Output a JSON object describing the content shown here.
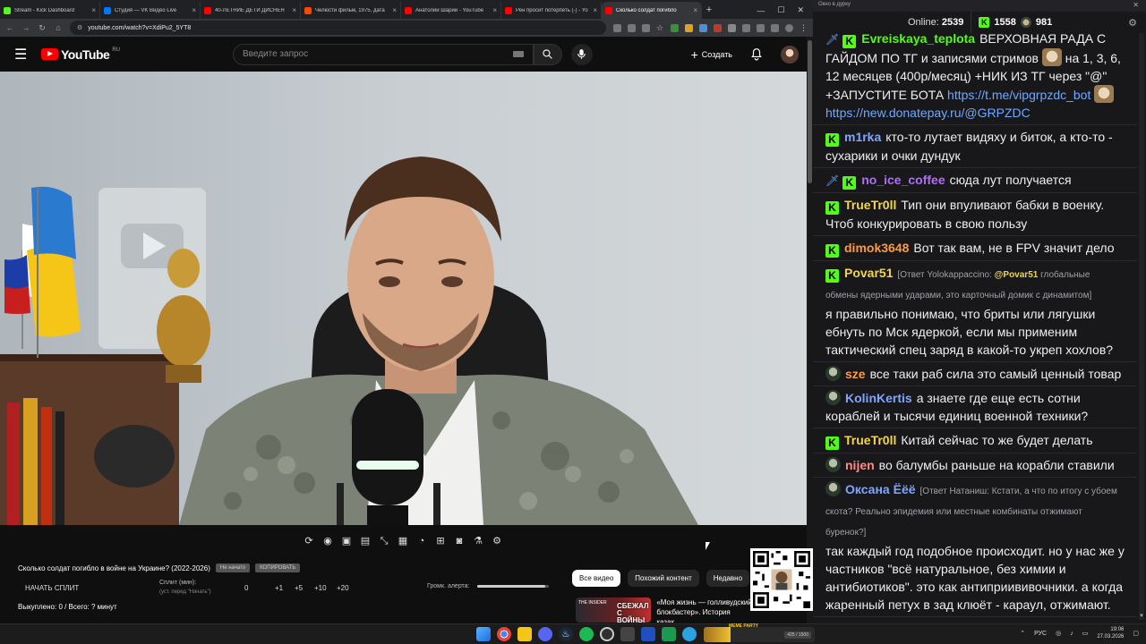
{
  "browser": {
    "tabs": [
      {
        "title": "Stream - Kick Dashboard",
        "color": "#53fc18",
        "active": false
      },
      {
        "title": "Студия — VK Видео Live",
        "color": "#0077ff",
        "active": false
      },
      {
        "title": "40-ЛЕТНИЕ ДЕТИ ДИСНЕЯ",
        "color": "#ff0000",
        "active": false
      },
      {
        "title": "Челюсти фильм, 1975, дата",
        "color": "#ff4500",
        "active": false
      },
      {
        "title": "Анатолий Шарий - YouTube",
        "color": "#ff0000",
        "active": false
      },
      {
        "title": "Рен просит потерпеть (-) - Yo",
        "color": "#ff0000",
        "active": false
      },
      {
        "title": "Сколько солдат погибло",
        "color": "#ff0000",
        "active": true
      }
    ],
    "url": "youtube.com/watch?v=XdiPu2_5YT8"
  },
  "youtube": {
    "logo_text": "YouTube",
    "region": "RU",
    "search_placeholder": "Введите запрос",
    "create_label": "Создать"
  },
  "video": {
    "title": "Сколько солдат погибло в войне на Украине? (2022-2026)",
    "btn_not_started": "Не начато",
    "btn_copy": "КОПИРОВАТЬ"
  },
  "controls": {
    "start_split": "НАЧАТЬ СПЛИТ",
    "split_label": "Сплит (мин):",
    "split_hint": "(уст. перед \"Начать\")",
    "split_value": "0",
    "increments": [
      "+1",
      "+5",
      "+10",
      "+20"
    ],
    "volume_label": "Громк. алерта:",
    "volume_level": 0.95,
    "done_text": "Выкуплено: 0 / Всего: ? минут"
  },
  "chips": [
    "Все видео",
    "Похожий контент",
    "Недавно"
  ],
  "recommended": {
    "thumb_text": "СБЕЖАЛ С ВОЙНЫ",
    "thumb_tag": "THE INSIDER",
    "title": "«Моя жизнь — голливудский блокбастер». История казак..."
  },
  "chat": {
    "window_title": "Окно в дурку",
    "online_label": "Online:",
    "online_count": "2539",
    "stat1": "1558",
    "stat2": "981",
    "messages": [
      {
        "badge": "sword",
        "user": "Evreiskaya_teplota",
        "color": "#53fc18",
        "text": "ВЕРХОВНАЯ РАДА С ГАЙДОМ ПО ТГ и записями стримов",
        "text2": "на 1, 3, 6, 12 месяцев (400р/месяц) +НИК ИЗ ТГ через \"@\" +ЗАПУСТИТЕ БОТА",
        "link1": "https://t.me/vipgrpzdc_bot",
        "link2": "https://new.donatepay.ru/@GRPZDC"
      },
      {
        "badge": "k",
        "user": "m1rka",
        "color": "#7ea6ff",
        "text": "кто-то лутает видяху и биток, а кто-то - сухарики и очки дундук"
      },
      {
        "badge": "sword",
        "user": "no_ice_coffee",
        "color": "#b06cff",
        "text": "сюда лут получается"
      },
      {
        "badge": "k",
        "user": "TrueTr0ll",
        "color": "#f5d642",
        "text": "Тип они впуливают бабки в военку. Чтоб конкурировать в свою пользу"
      },
      {
        "badge": "k",
        "user": "dimok3648",
        "color": "#ff9a3c",
        "text": "Вот так вам, не в FPV значит дело"
      },
      {
        "badge": "k",
        "user": "Povar51",
        "color": "#f5d642",
        "reply_prefix": "[Ответ Yolokappaccino:",
        "reply_user": "@Povar51",
        "reply_text": "глобальные обмены ядерными ударами, это карточный домик с динамитом]",
        "text": "я правильно понимаю, что бриты или лягушки ебнуть по Мск ядеркой, если мы применим тактический спец заряд в какой-то укреп хохлов?"
      },
      {
        "badge": "avatar",
        "user": "sze",
        "color": "#ff9a3c",
        "text": "все таки раб сила это самый ценный товар"
      },
      {
        "badge": "avatar",
        "user": "KolinKertis",
        "color": "#7ea6ff",
        "text": "а знаете где еще есть сотни кораблей и тысячи единиц военной техники?"
      },
      {
        "badge": "k",
        "user": "TrueTr0ll",
        "color": "#f5d642",
        "text": "Китай сейчас то же будет делать"
      },
      {
        "badge": "avatar",
        "user": "nijen",
        "color": "#ff8a8a",
        "text": "во балумбы раньше на корабли ставили"
      },
      {
        "badge": "avatar",
        "user": "Оксана Ёёё",
        "color": "#7ea6ff",
        "reply_prefix": "[Ответ Натаниш: Кстати, а что по итогу с убоем скота? Реально эпидемия или местные комбинаты отжимают буренок?]",
        "reply_user": "",
        "reply_text": "",
        "text": "так каждый год подобное происходит. но у нас же у частников \"всё натуральное, без химии и антибиотиков\". это как антиприививочники. а когда жаренный петух в зад клюёт - караул, отжимают."
      }
    ]
  },
  "taskbar": {
    "media_label": "MEME PARTY",
    "media_time": "425 / 1500",
    "lang": "РУС",
    "time": "19:06",
    "date": "27.03.2026"
  }
}
